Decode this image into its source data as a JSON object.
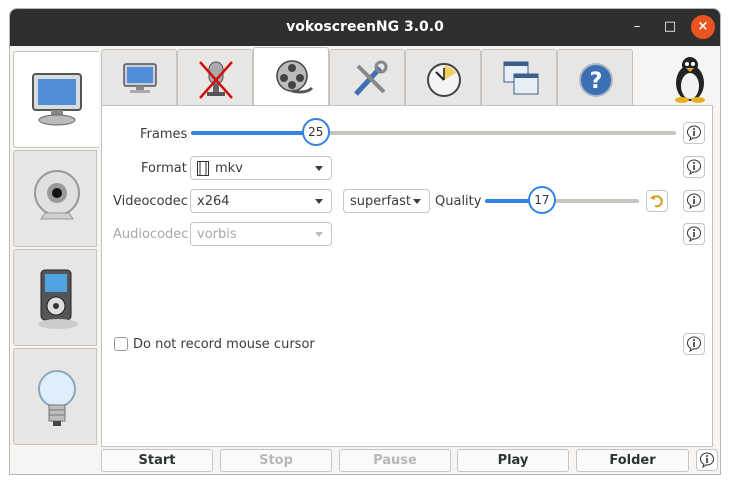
{
  "window": {
    "title": "vokoscreenNG 3.0.0"
  },
  "icons": {
    "minimize": "minimize-icon",
    "maximize": "maximize-icon",
    "close": "close-icon",
    "side_tabs": [
      "monitor-icon",
      "webcam-icon",
      "media-player-icon",
      "lightbulb-icon"
    ],
    "top_tabs": [
      "screen-icon",
      "microphone-muted-icon",
      "film-reel-icon",
      "tools-icon",
      "timer-icon",
      "windows-icon",
      "help-icon"
    ],
    "linux": "tux-icon"
  },
  "window_controls": {
    "minimize": "–",
    "maximize": "□",
    "close": "×"
  },
  "video": {
    "frames": {
      "label": "Frames",
      "value": 25,
      "min": 1,
      "max": 100
    },
    "format": {
      "label": "Format",
      "value": "mkv"
    },
    "videocodec": {
      "label": "Videocodec",
      "value": "x264"
    },
    "preset": {
      "value": "superfast"
    },
    "quality": {
      "label": "Quality",
      "value": 17,
      "min": 0,
      "max": 50
    },
    "audiocodec": {
      "label": "Audiocodec",
      "value": "vorbis"
    },
    "mouse_cursor": {
      "label": "Do not record mouse cursor",
      "checked": false
    }
  },
  "buttons": {
    "start": "Start",
    "stop": "Stop",
    "pause": "Pause",
    "play": "Play",
    "folder": "Folder"
  },
  "colors": {
    "accent": "#3584e4",
    "close": "#e95420",
    "titlebar": "#2f2f2f"
  }
}
